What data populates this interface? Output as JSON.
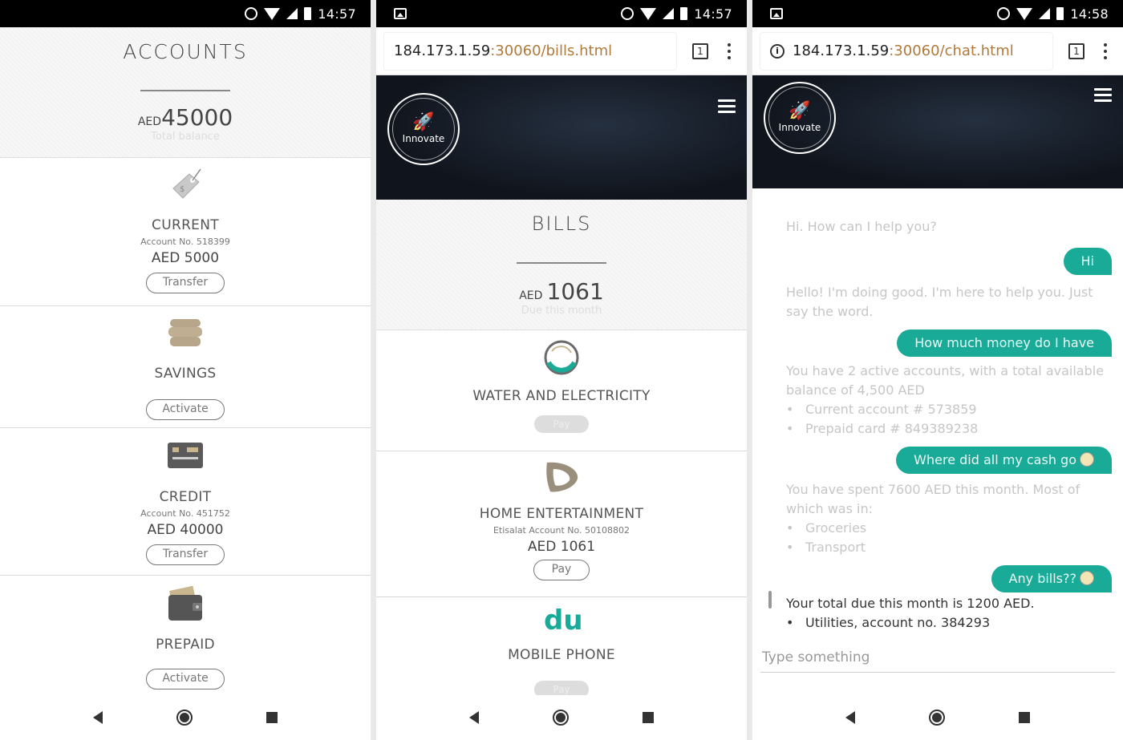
{
  "accounts_screen": {
    "status_time": "14:57",
    "title": "ACCOUNTS",
    "currency": "AED",
    "total": "45000",
    "total_caption": "Total balance",
    "accounts": [
      {
        "name": "CURRENT",
        "number": "Account No. 518399",
        "amount": "AED 5000",
        "action": "Transfer",
        "icon": "price-tag-icon"
      },
      {
        "name": "SAVINGS",
        "number": "",
        "amount": "",
        "action": "Activate",
        "icon": "coins-icon"
      },
      {
        "name": "CREDIT",
        "number": "Account No. 451752",
        "amount": "AED 40000",
        "action": "Transfer",
        "icon": "credit-card-icon"
      },
      {
        "name": "PREPAID",
        "number": "",
        "amount": "",
        "action": "Activate",
        "icon": "wallet-icon"
      }
    ]
  },
  "bills_screen": {
    "status_time": "14:57",
    "url_host": "184.173.1.59",
    "url_path": ":30060/bills.html",
    "tab_count": "1",
    "logo_text": "Innovate",
    "title": "BILLS",
    "currency": "AED",
    "total": "1061",
    "total_caption": "Due this month",
    "bills": [
      {
        "name": "WATER AND ELECTRICITY",
        "account": "",
        "amount": "",
        "action": "Pay",
        "enabled": false,
        "icon": "dewa-logo-icon"
      },
      {
        "name": "HOME ENTERTAINMENT",
        "account": "Etisalat Account No. 50108802",
        "amount": "AED 1061",
        "action": "Pay",
        "enabled": true,
        "icon": "etisalat-logo-icon"
      },
      {
        "name": "MOBILE PHONE",
        "account": "",
        "amount": "",
        "action": "Pay",
        "enabled": false,
        "icon": "du-logo-icon"
      }
    ]
  },
  "chat_screen": {
    "status_time": "14:58",
    "url_host": "184.173.1.59",
    "url_path": ":30060/chat.html",
    "tab_count": "1",
    "logo_text": "Innovate",
    "messages": {
      "bot1": "Hi. How can I help you?",
      "me1": "Hi",
      "bot2": "Hello! I'm doing good. I'm here to help you. Just say the word.",
      "me2": "How much money do I have",
      "bot3": "You have 2 active accounts, with a total available balance of 4,500 AED",
      "bot3_items": [
        "Current account # 573859",
        "Prepaid card # 849389238"
      ],
      "me3": "Where did all my cash go",
      "bot4": "You have spent 7600 AED this month. Most of which was in:",
      "bot4_items": [
        "Groceries",
        "Transport"
      ],
      "me4": "Any bills??",
      "bot5": "Your total due this month is 1200 AED.",
      "bot5_items": [
        "Utilities, account no. 384293"
      ]
    },
    "input_placeholder": "Type something"
  },
  "colors": {
    "accent": "#1aaa98",
    "hero": "#13171f"
  }
}
